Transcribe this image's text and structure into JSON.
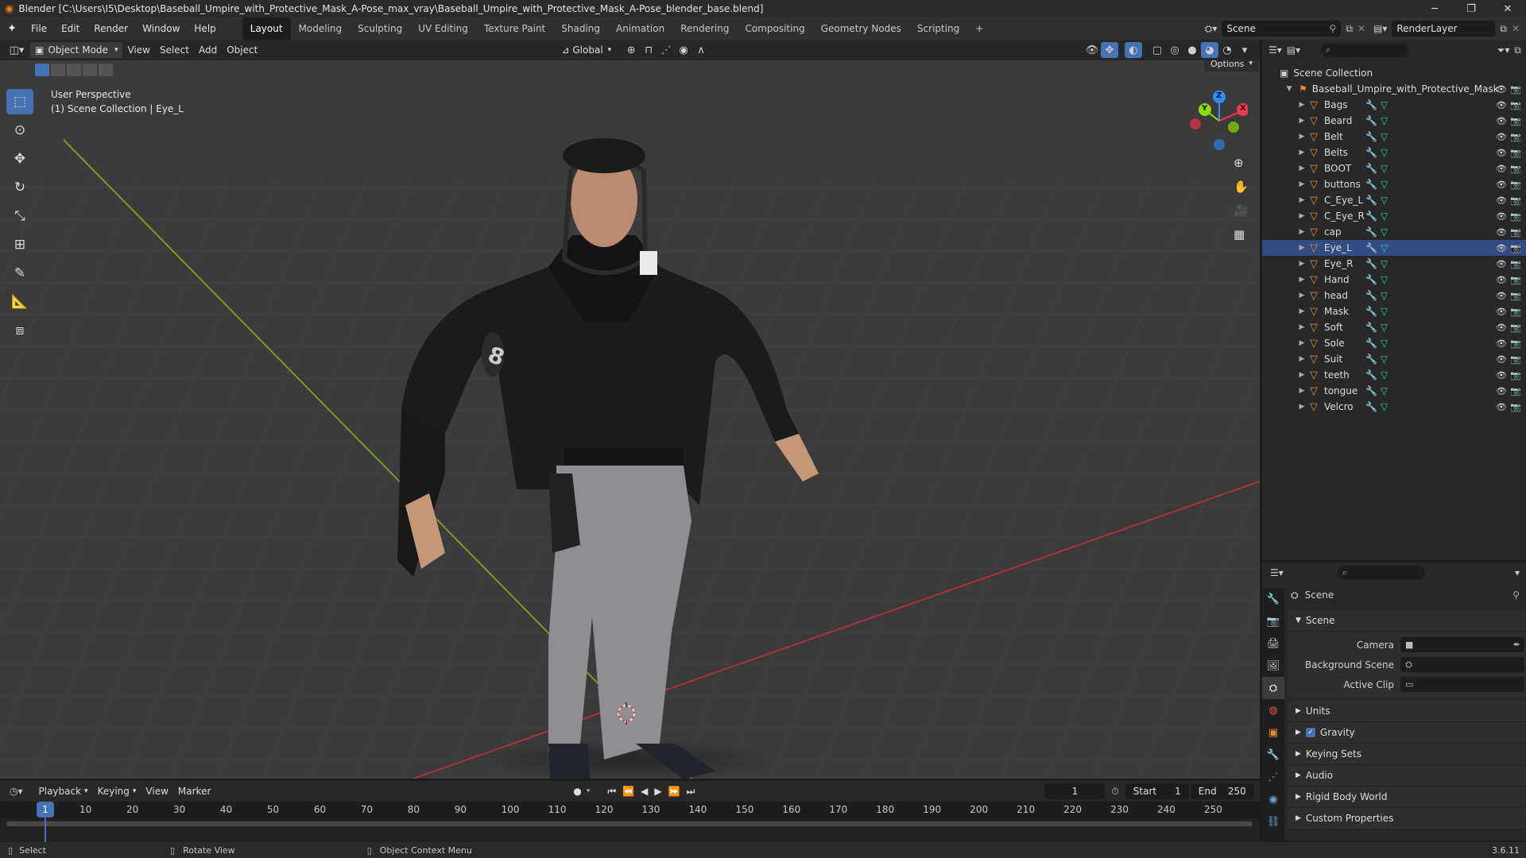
{
  "window": {
    "title": "Blender [C:\\Users\\I5\\Desktop\\Baseball_Umpire_with_Protective_Mask_A-Pose_max_vray\\Baseball_Umpire_with_Protective_Mask_A-Pose_blender_base.blend]",
    "minimize": "─",
    "maximize": "❐",
    "close": "✕"
  },
  "menu": [
    "File",
    "Edit",
    "Render",
    "Window",
    "Help"
  ],
  "workspaces": [
    "Layout",
    "Modeling",
    "Sculpting",
    "UV Editing",
    "Texture Paint",
    "Shading",
    "Animation",
    "Rendering",
    "Compositing",
    "Geometry Nodes",
    "Scripting"
  ],
  "active_workspace": "Layout",
  "add_workspace": "+",
  "scene_name": "Scene",
  "view_layer": "RenderLayer",
  "viewport_header": {
    "mode": "Object Mode",
    "menus": [
      "View",
      "Select",
      "Add",
      "Object"
    ],
    "orientation": "Global",
    "options": "Options"
  },
  "viewport": {
    "perspective": "User Perspective",
    "collection_info": "(1) Scene Collection | Eye_L",
    "gizmo": {
      "x": "X",
      "y": "Y",
      "z": "Z"
    }
  },
  "outliner": {
    "root": "Scene Collection",
    "collection": "Baseball_Umpire_with_Protective_Mask",
    "objects": [
      "Bags",
      "Beard",
      "Belt",
      "Belts",
      "BOOT",
      "buttons",
      "C_Eye_L",
      "C_Eye_R",
      "cap",
      "Eye_L",
      "Eye_R",
      "Hand",
      "head",
      "Mask",
      "Soft",
      "Sole",
      "Suit",
      "teeth",
      "tongue",
      "Velcro"
    ],
    "selected": "Eye_L"
  },
  "properties": {
    "context": "Scene",
    "panel": "Scene",
    "camera_label": "Camera",
    "background_scene_label": "Background Scene",
    "active_clip_label": "Active Clip",
    "sections": [
      "Units",
      "Gravity",
      "Keying Sets",
      "Audio",
      "Rigid Body World",
      "Custom Properties"
    ],
    "gravity_checked": true
  },
  "timeline": {
    "menus": [
      "Playback",
      "Keying",
      "View",
      "Marker"
    ],
    "current_frame": "1",
    "start_label": "Start",
    "start": "1",
    "end_label": "End",
    "end": "250",
    "ticks": [
      "1",
      "10",
      "20",
      "30",
      "40",
      "50",
      "60",
      "70",
      "80",
      "90",
      "100",
      "110",
      "120",
      "130",
      "140",
      "150",
      "160",
      "170",
      "180",
      "190",
      "200",
      "210",
      "220",
      "230",
      "240",
      "250"
    ]
  },
  "statusbar": {
    "select": "Select",
    "rotate": "Rotate View",
    "context_menu": "Object Context Menu",
    "version": "3.6.11"
  },
  "colors": {
    "accent": "#4772b3",
    "object": "#e38d38",
    "mesh": "#39c6b0",
    "modifier": "#6fa3d6",
    "axis_x": "#ff3352",
    "axis_y": "#8bdc00",
    "axis_z": "#2890ff"
  }
}
